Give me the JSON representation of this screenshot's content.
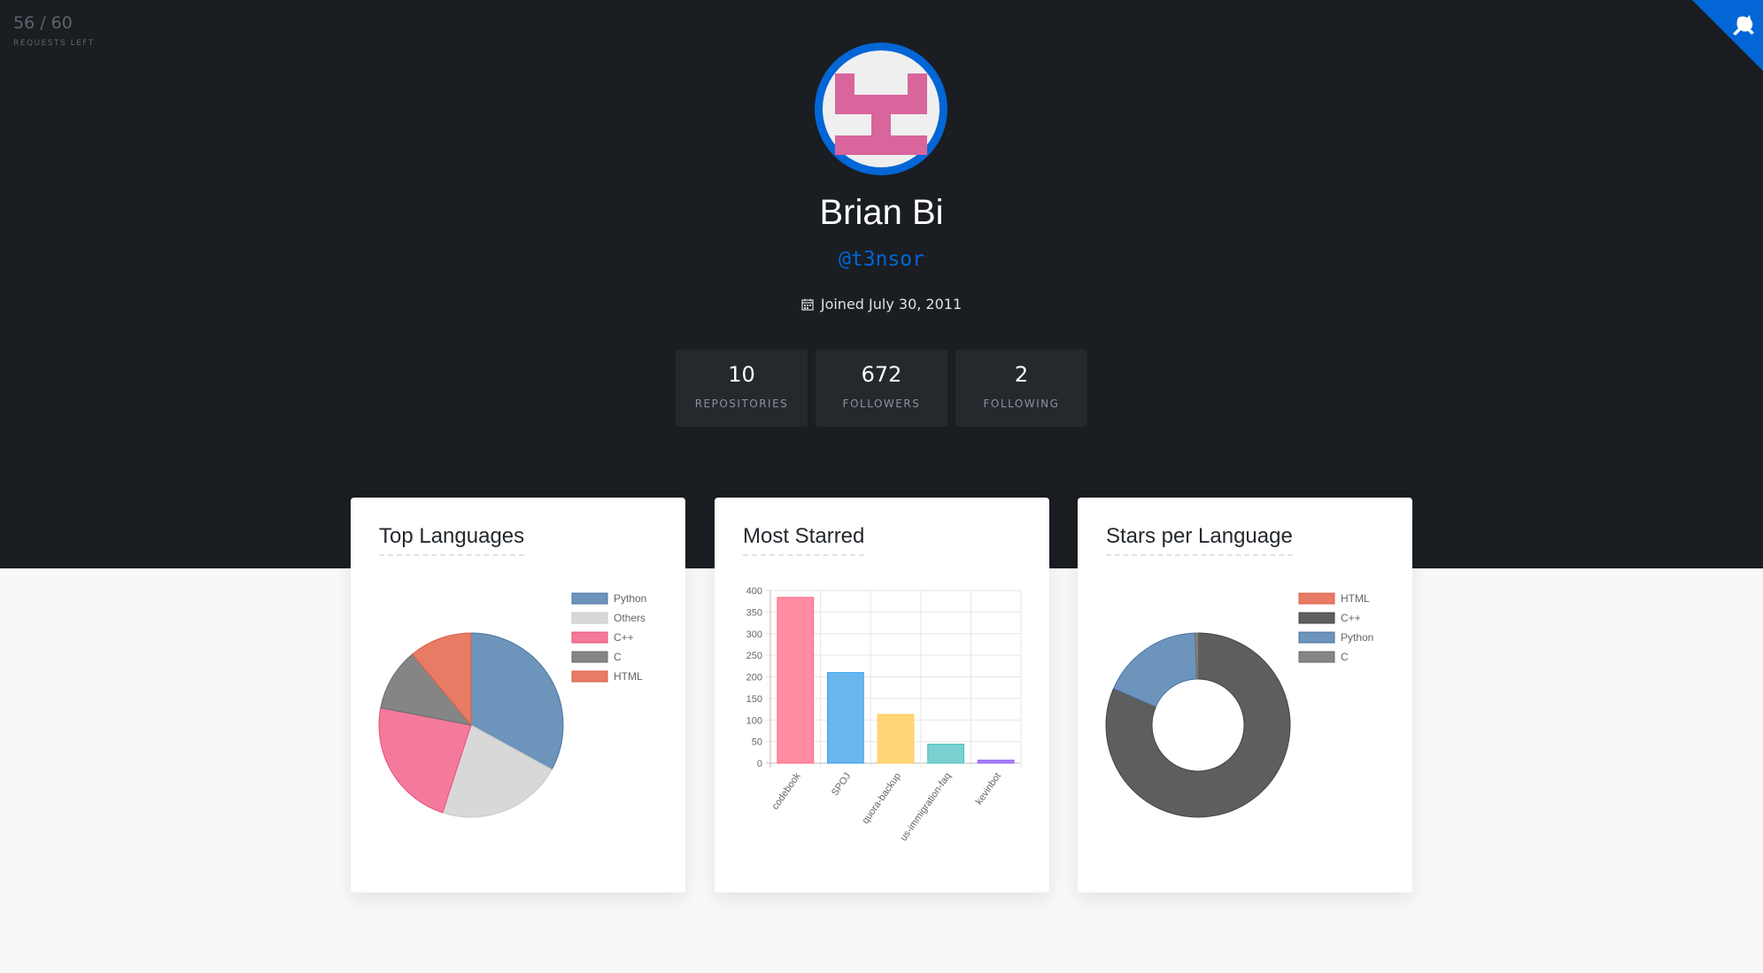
{
  "rate_limit": {
    "count": "56 / 60",
    "label": "REQUESTS LEFT"
  },
  "user": {
    "name": "Brian Bi",
    "handle": "@t3nsor",
    "joined": "Joined July 30, 2011"
  },
  "stats": [
    {
      "value": "10",
      "label": "REPOSITORIES"
    },
    {
      "value": "672",
      "label": "FOLLOWERS"
    },
    {
      "value": "2",
      "label": "FOLLOWING"
    }
  ],
  "cards": {
    "languages_title": "Top Languages",
    "starred_title": "Most Starred",
    "stars_lang_title": "Stars per Language"
  },
  "colors": {
    "hero_bg": "#1a1d21",
    "accent": "#0366d6",
    "avatar_pink": "#d9659d"
  },
  "chart_data": [
    {
      "type": "pie",
      "title": "Top Languages",
      "legend_position": "top-right",
      "labels": [
        "Python",
        "Others",
        "C++",
        "C",
        "HTML"
      ],
      "values": [
        33,
        22,
        23,
        11,
        11
      ],
      "colors": [
        "#6d95bb",
        "#d8d8d8",
        "#f47a9c",
        "#858585",
        "#e87b63"
      ],
      "border_colors": [
        "#4b73a0",
        "#c8c8c8",
        "#e8507c",
        "#6a6a6a",
        "#d9624a"
      ]
    },
    {
      "type": "bar",
      "title": "Most Starred",
      "categories": [
        "codebook",
        "SPOJ",
        "quora-backup",
        "us-immigration-faq",
        "kevinbot"
      ],
      "values": [
        384,
        210,
        113,
        44,
        7
      ],
      "ylim": [
        0,
        400
      ],
      "yticks": [
        0,
        50,
        100,
        150,
        200,
        250,
        300,
        350,
        400
      ],
      "grid": true,
      "colors": [
        "#ff8ca3",
        "#6ab7ee",
        "#ffd576",
        "#7bd0d0",
        "#a37ef5"
      ],
      "border_colors": [
        "#ff6384",
        "#36a2eb",
        "#ffce56",
        "#4bc0c0",
        "#9966ff"
      ]
    },
    {
      "type": "pie",
      "subtype": "doughnut",
      "title": "Stars per Language",
      "legend_position": "top-right",
      "labels": [
        "HTML",
        "C++",
        "Python",
        "C"
      ],
      "values": [
        0,
        81.5,
        18,
        0.5
      ],
      "colors": [
        "#e87b63",
        "#5e5e5e",
        "#6d95bb",
        "#858585"
      ],
      "border_colors": [
        "#d9624a",
        "#444444",
        "#4b73a0",
        "#6a6a6a"
      ]
    }
  ]
}
